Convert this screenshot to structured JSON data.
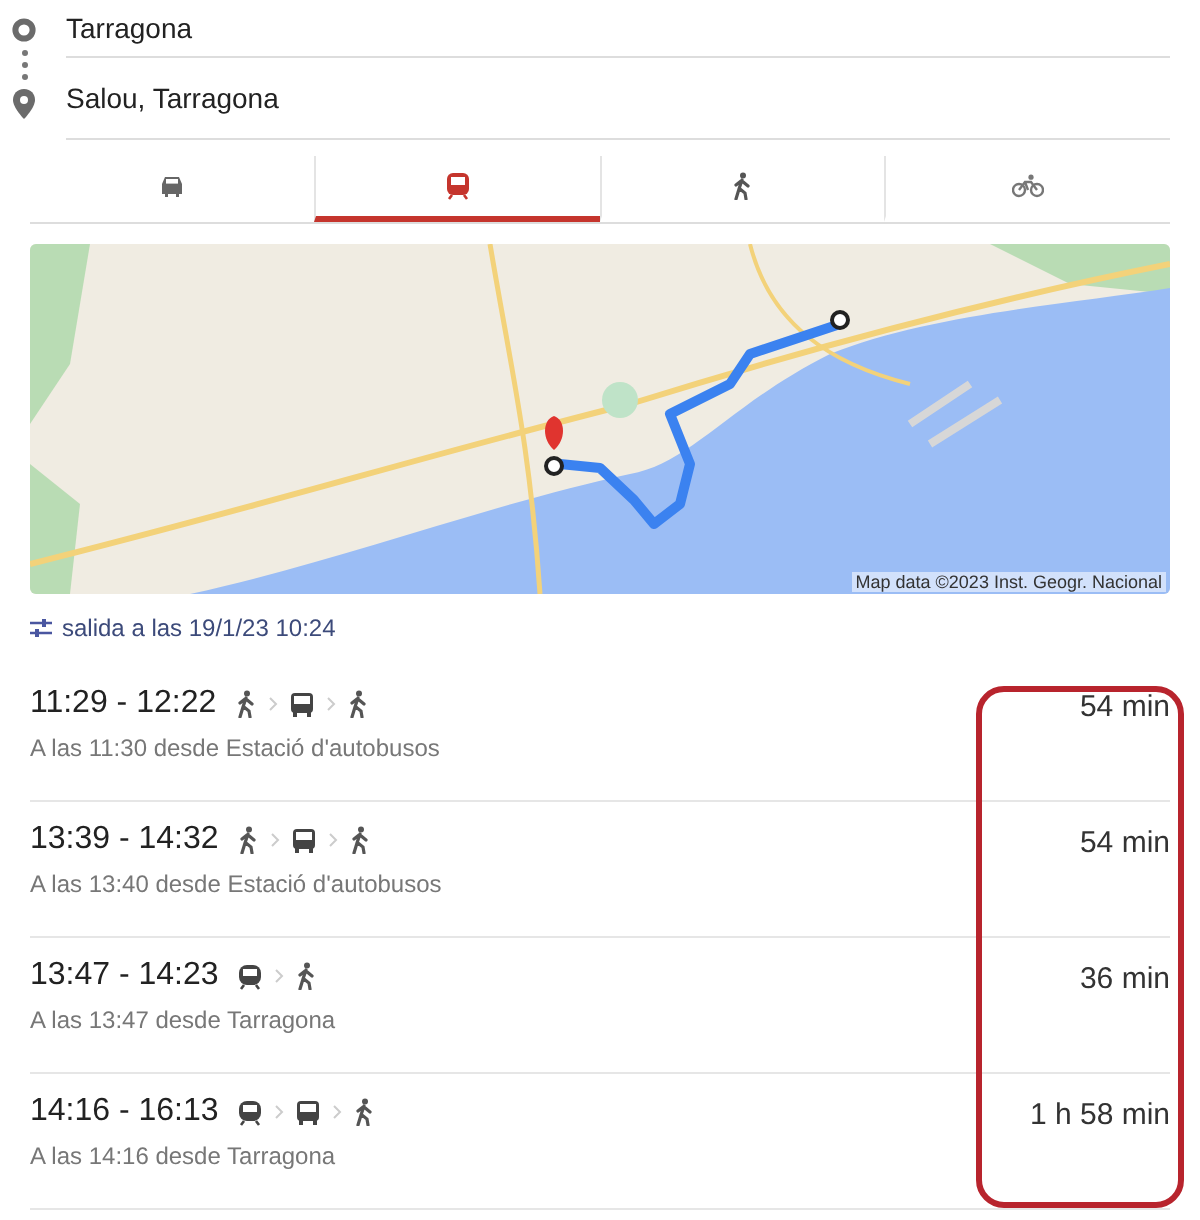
{
  "directions": {
    "origin": "Tarragona",
    "destination": "Salou, Tarragona"
  },
  "tabs": [
    {
      "kind": "car",
      "selected": false
    },
    {
      "kind": "transit",
      "selected": true
    },
    {
      "kind": "walk",
      "selected": false
    },
    {
      "kind": "bike",
      "selected": false
    }
  ],
  "map": {
    "attribution": "Map data ©2023 Inst. Geogr. Nacional"
  },
  "departure": "salida a las 19/1/23 10:24",
  "highlight_durations": true,
  "routes": [
    {
      "times": "11:29 - 12:22",
      "steps": [
        {
          "kind": "walk"
        },
        {
          "kind": "bus"
        },
        {
          "kind": "walk"
        }
      ],
      "detail": "A las 11:30 desde Estació d'autobusos",
      "duration": "54 min"
    },
    {
      "times": "13:39 - 14:32",
      "steps": [
        {
          "kind": "walk"
        },
        {
          "kind": "bus"
        },
        {
          "kind": "walk"
        }
      ],
      "detail": "A las 13:40 desde Estació d'autobusos",
      "duration": "54 min"
    },
    {
      "times": "13:47 - 14:23",
      "steps": [
        {
          "kind": "train"
        },
        {
          "kind": "walk"
        }
      ],
      "detail": "A las 13:47 desde Tarragona",
      "duration": "36 min"
    },
    {
      "times": "14:16 - 16:13",
      "steps": [
        {
          "kind": "train"
        },
        {
          "kind": "bus"
        },
        {
          "kind": "walk"
        }
      ],
      "detail": "A las 14:16 desde Tarragona",
      "duration": "1 h 58 min"
    }
  ]
}
